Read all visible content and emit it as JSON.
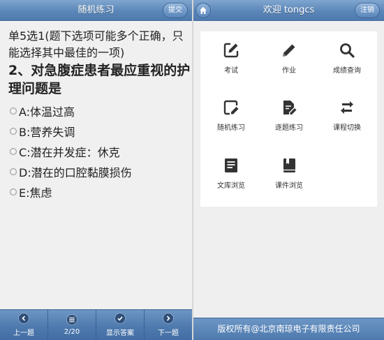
{
  "left": {
    "header": {
      "title": "随机练习",
      "submit_label": "提交"
    },
    "question": {
      "heading": "单5选1(题下选项可能多个正确，只能选择其中最佳的一项)",
      "text": "2、对急腹症患者最应重视的护理问题是",
      "options": [
        "A:体温过高",
        "B:营养失调",
        "C:潜在并发症：休克",
        "D:潜在的口腔黏膜损伤",
        "E:焦虑"
      ]
    },
    "bottom_nav": {
      "prev_label": "上一题",
      "progress_label": "2/20",
      "show_answer_label": "显示答案",
      "next_label": "下一题"
    }
  },
  "right": {
    "header": {
      "title": "欢迎 tongcs",
      "logout_label": "注销"
    },
    "menu": [
      {
        "label": "考试",
        "icon": "edit-square-icon"
      },
      {
        "label": "作业",
        "icon": "pencil-icon"
      },
      {
        "label": "成绩查询",
        "icon": "search-icon"
      },
      {
        "label": "随机练习",
        "icon": "frame-edit-icon"
      },
      {
        "label": "逐题练习",
        "icon": "document-edit-icon"
      },
      {
        "label": "课程切换",
        "icon": "swap-arrows-icon"
      },
      {
        "label": "文库浏览",
        "icon": "list-document-icon"
      },
      {
        "label": "课件浏览",
        "icon": "book-icon"
      }
    ],
    "footer": "版权所有@北京南琼电子有限责任公司"
  }
}
